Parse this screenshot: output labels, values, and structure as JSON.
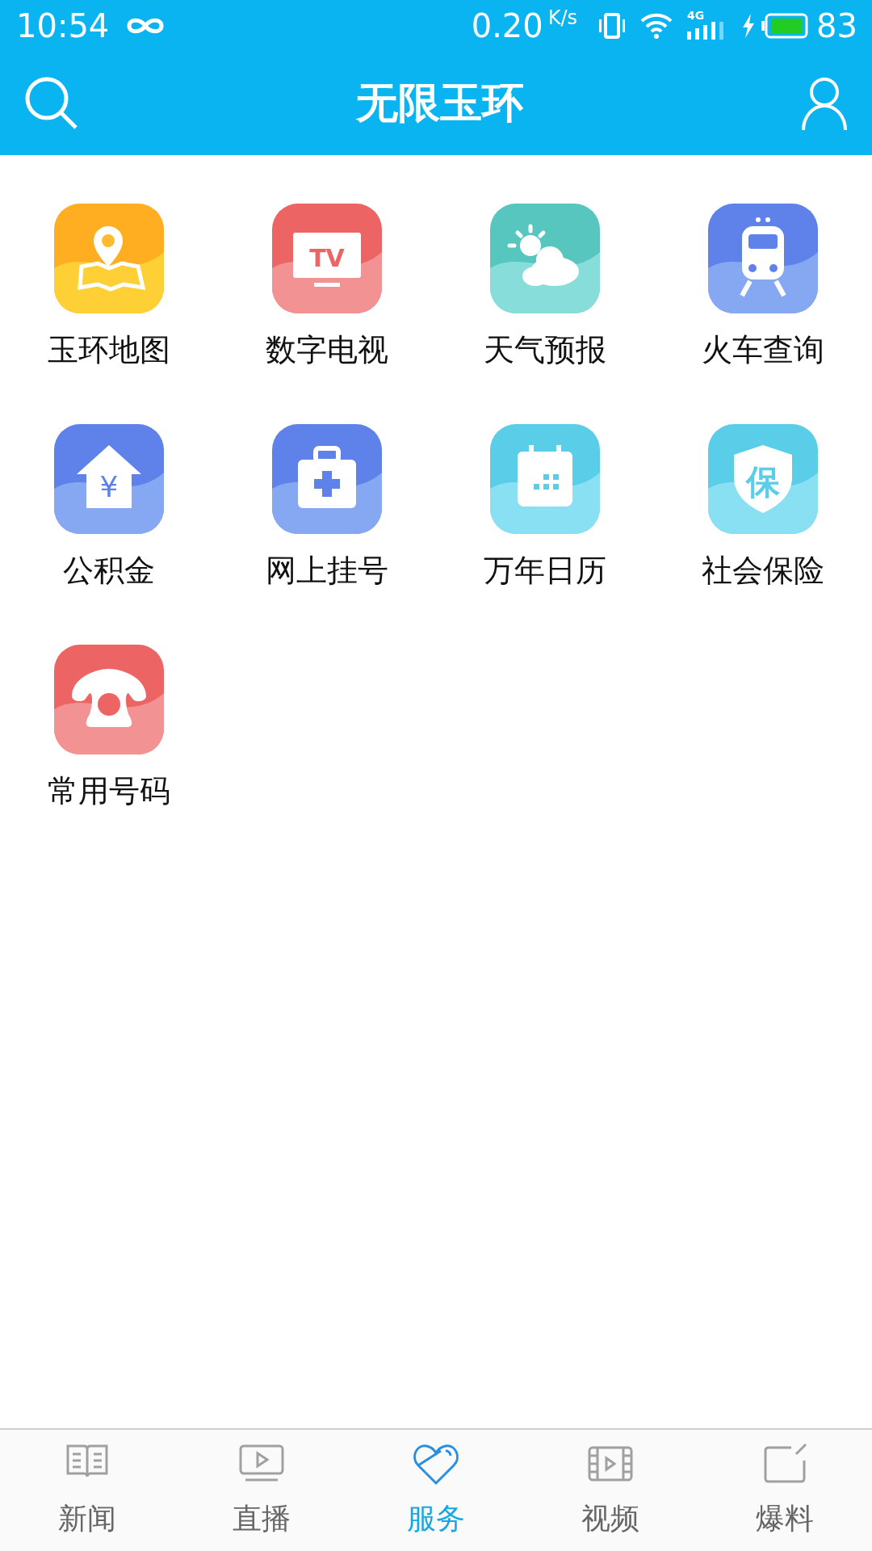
{
  "status_bar": {
    "time": "10:54",
    "net_speed": "0.20",
    "speed_unit": "K/s",
    "network_type": "4G",
    "battery": "83"
  },
  "header": {
    "title": "无限玉环"
  },
  "services": [
    {
      "label": "玉环地图",
      "kind": "map"
    },
    {
      "label": "数字电视",
      "kind": "tv",
      "icon_text": "TV"
    },
    {
      "label": "天气预报",
      "kind": "weather"
    },
    {
      "label": "火车查询",
      "kind": "train"
    },
    {
      "label": "公积金",
      "kind": "fund",
      "icon_text": "¥"
    },
    {
      "label": "网上挂号",
      "kind": "hospital"
    },
    {
      "label": "万年日历",
      "kind": "calendar"
    },
    {
      "label": "社会保险",
      "kind": "insurance",
      "icon_text": "保"
    },
    {
      "label": "常用号码",
      "kind": "phone"
    }
  ],
  "tabs": [
    {
      "label": "新闻",
      "kind": "news",
      "selected": false
    },
    {
      "label": "直播",
      "kind": "live",
      "selected": false
    },
    {
      "label": "服务",
      "kind": "service",
      "selected": true
    },
    {
      "label": "视频",
      "kind": "video",
      "selected": false
    },
    {
      "label": "爆料",
      "kind": "report",
      "selected": false
    }
  ]
}
